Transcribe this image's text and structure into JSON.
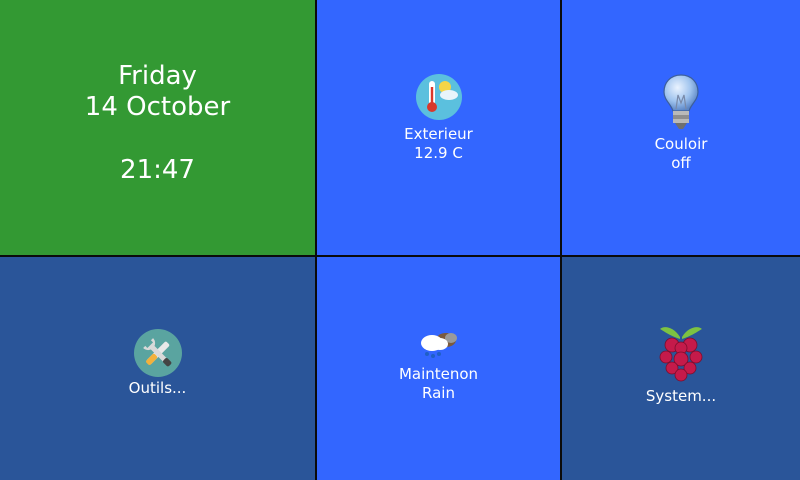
{
  "clock": {
    "day": "Friday",
    "date": "14 October",
    "time": "21:47",
    "color": "#339933"
  },
  "tiles": {
    "exterieur": {
      "label": "Exterieur",
      "value": "12.9 C",
      "icon": "thermometer-weather-icon",
      "color": "#3366ff"
    },
    "couloir": {
      "label": "Couloir",
      "value": "off",
      "icon": "light-bulb-icon",
      "color": "#3366ff"
    },
    "outils": {
      "label": "Outils...",
      "icon": "tools-icon",
      "color": "#2a5599"
    },
    "maintenon": {
      "label": "Maintenon",
      "value": "Rain",
      "icon": "rain-cloud-icon",
      "color": "#3366ff"
    },
    "system": {
      "label": "System...",
      "icon": "raspberry-pi-icon",
      "color": "#2a5599"
    }
  }
}
